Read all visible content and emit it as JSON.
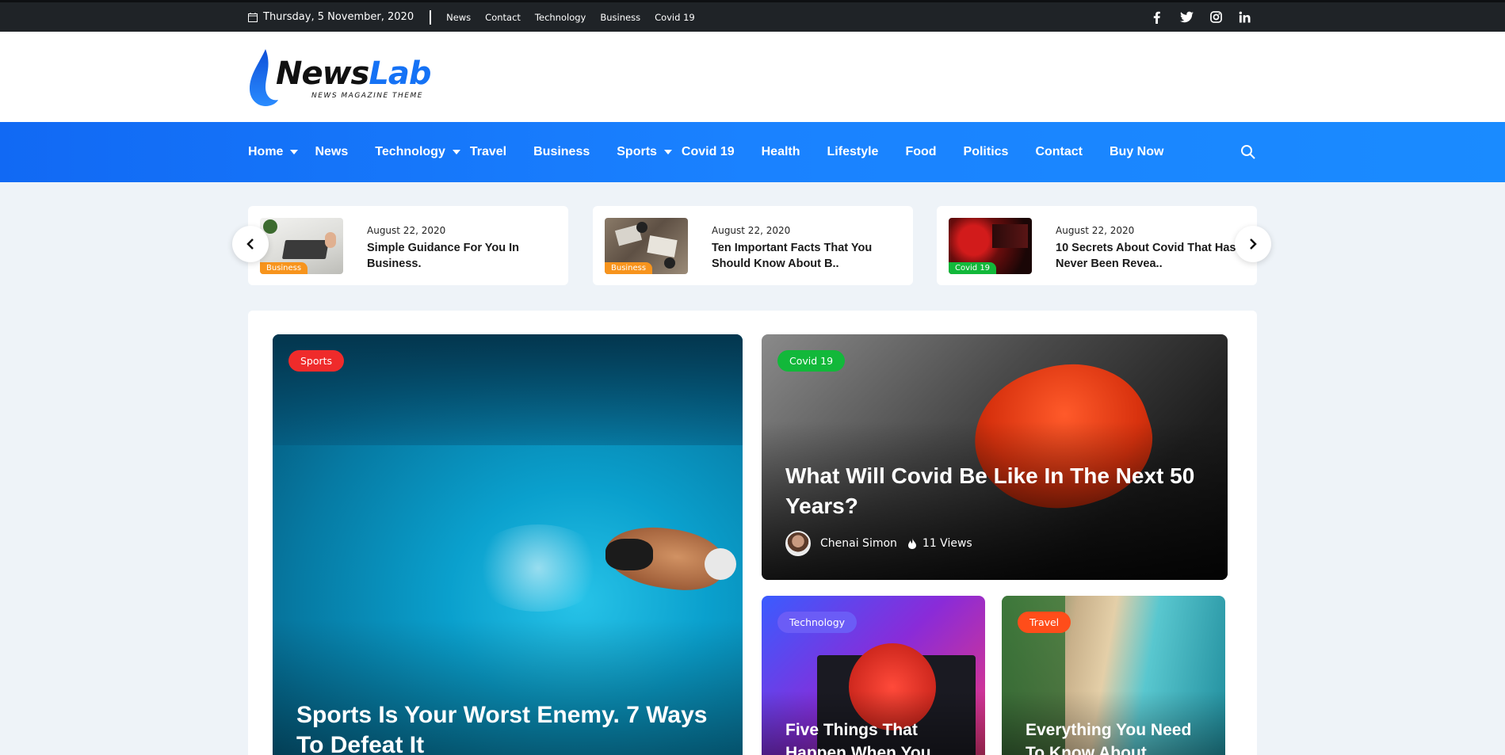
{
  "topbar": {
    "date": "Thursday, 5 November, 2020",
    "links": [
      "News",
      "Contact",
      "Technology",
      "Business",
      "Covid 19"
    ],
    "socials": [
      "facebook-icon",
      "twitter-icon",
      "instagram-icon",
      "linkedin-icon"
    ]
  },
  "logo": {
    "part1": "News",
    "part2": "Lab",
    "tagline": "NEWS MAGAZINE THEME"
  },
  "nav": {
    "items": [
      "Home",
      "News",
      "Technology",
      "Travel",
      "Business",
      "Sports",
      "Covid 19",
      "Health",
      "Lifestyle",
      "Food",
      "Politics",
      "Contact",
      "Buy Now"
    ]
  },
  "slider": {
    "cards": [
      {
        "category": "Business",
        "date": "August 22, 2020",
        "title1": "Simple Guidance For You In",
        "title2": "Business."
      },
      {
        "category": "Business",
        "date": "August 22, 2020",
        "title1": "Ten Important Facts That You",
        "title2": "Should Know About B.."
      },
      {
        "category": "Covid 19",
        "date": "August 22, 2020",
        "title1": "10 Secrets About Covid That Has",
        "title2": "Never Been Revea.."
      }
    ]
  },
  "features": {
    "big": {
      "category": "Sports",
      "title1": "Sports Is Your Worst Enemy. 7 Ways",
      "title2": "To Defeat It"
    },
    "top": {
      "category": "Covid 19",
      "title1": "What Will Covid Be Like In The Next 50",
      "title2": "Years?",
      "author": "Chenai Simon",
      "views": "11 Views"
    },
    "small1": {
      "category": "Technology",
      "title1": "Five Things That",
      "title2": "Happen When You"
    },
    "small2": {
      "category": "Travel",
      "title1": "Everything You Need",
      "title2": "To Know About"
    }
  },
  "colors": {
    "brand": "#1572f5",
    "sports": "#ef2b2b",
    "covid": "#12b83a",
    "business": "#f7941d",
    "technology": "#6b5cf6",
    "travel": "#ff4d1a"
  }
}
